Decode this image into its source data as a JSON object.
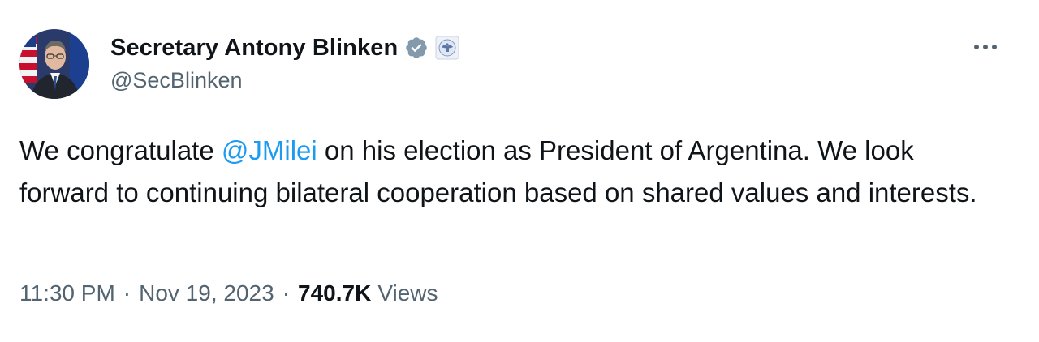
{
  "author": {
    "display_name": "Secretary Antony Blinken",
    "handle": "@SecBlinken",
    "verified_icon": "verified-badge-icon",
    "affiliation_icon": "us-state-department-seal-icon"
  },
  "tweet": {
    "text_before_mention": "We congratulate ",
    "mention": "@JMilei",
    "text_after_mention": " on his election as President of Argentina. We look forward to continuing bilateral cooperation based on shared values and interests."
  },
  "meta": {
    "time": "11:30 PM",
    "separator": "·",
    "date": "Nov 19, 2023",
    "views_count": "740.7K",
    "views_label": "Views"
  },
  "colors": {
    "text": "#0f1419",
    "secondary": "#536471",
    "link": "#1d9bf0",
    "badge": "#829aab"
  }
}
